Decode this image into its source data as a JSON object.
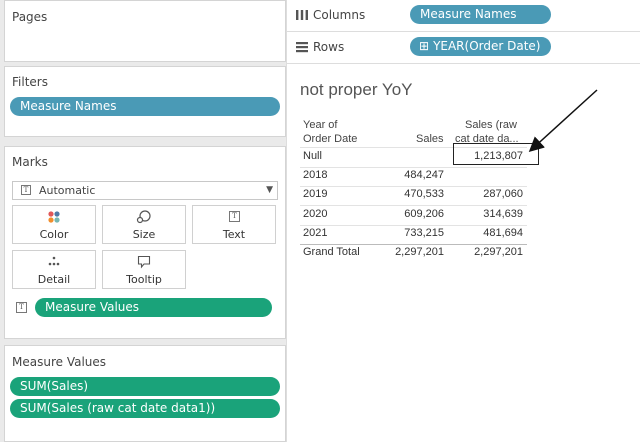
{
  "left_panel": {
    "pages_title": "Pages",
    "filters_title": "Filters",
    "filter_pill": "Measure Names",
    "marks_title": "Marks",
    "mark_type": "Automatic",
    "mark_buttons": {
      "color": "Color",
      "size": "Size",
      "text": "Text",
      "detail": "Detail",
      "tooltip": "Tooltip"
    },
    "marks_pill": "Measure Values",
    "measure_values_title": "Measure Values",
    "measure_values_pills": [
      "SUM(Sales)",
      "SUM(Sales (raw cat date data1))"
    ]
  },
  "shelves": {
    "columns_label": "Columns",
    "columns_pill": "Measure Names",
    "rows_label": "Rows",
    "rows_pill": "YEAR(Order Date)",
    "rows_pill_prefix": "⊞"
  },
  "view": {
    "title": "not proper YoY",
    "header": {
      "dim_line1": "Year of",
      "dim_line2": "Order Date",
      "col1": "Sales",
      "col2_line1": "Sales (raw",
      "col2_line2": "cat date da..."
    },
    "rows": [
      {
        "label": "Null",
        "sales": "",
        "sales_raw": "1,213,807"
      },
      {
        "label": "2018",
        "sales": "484,247",
        "sales_raw": ""
      },
      {
        "label": "2019",
        "sales": "470,533",
        "sales_raw": "287,060"
      },
      {
        "label": "2020",
        "sales": "609,206",
        "sales_raw": "314,639"
      },
      {
        "label": "2021",
        "sales": "733,215",
        "sales_raw": "481,694"
      },
      {
        "label": "Grand Total",
        "sales": "2,297,201",
        "sales_raw": "2,297,201"
      }
    ]
  },
  "colors": {
    "pill_blue": "#4a9ab6",
    "pill_green": "#1aa37a",
    "color_dots": [
      "#e15759",
      "#4e79a7",
      "#f28e2b",
      "#76b7b2"
    ]
  }
}
